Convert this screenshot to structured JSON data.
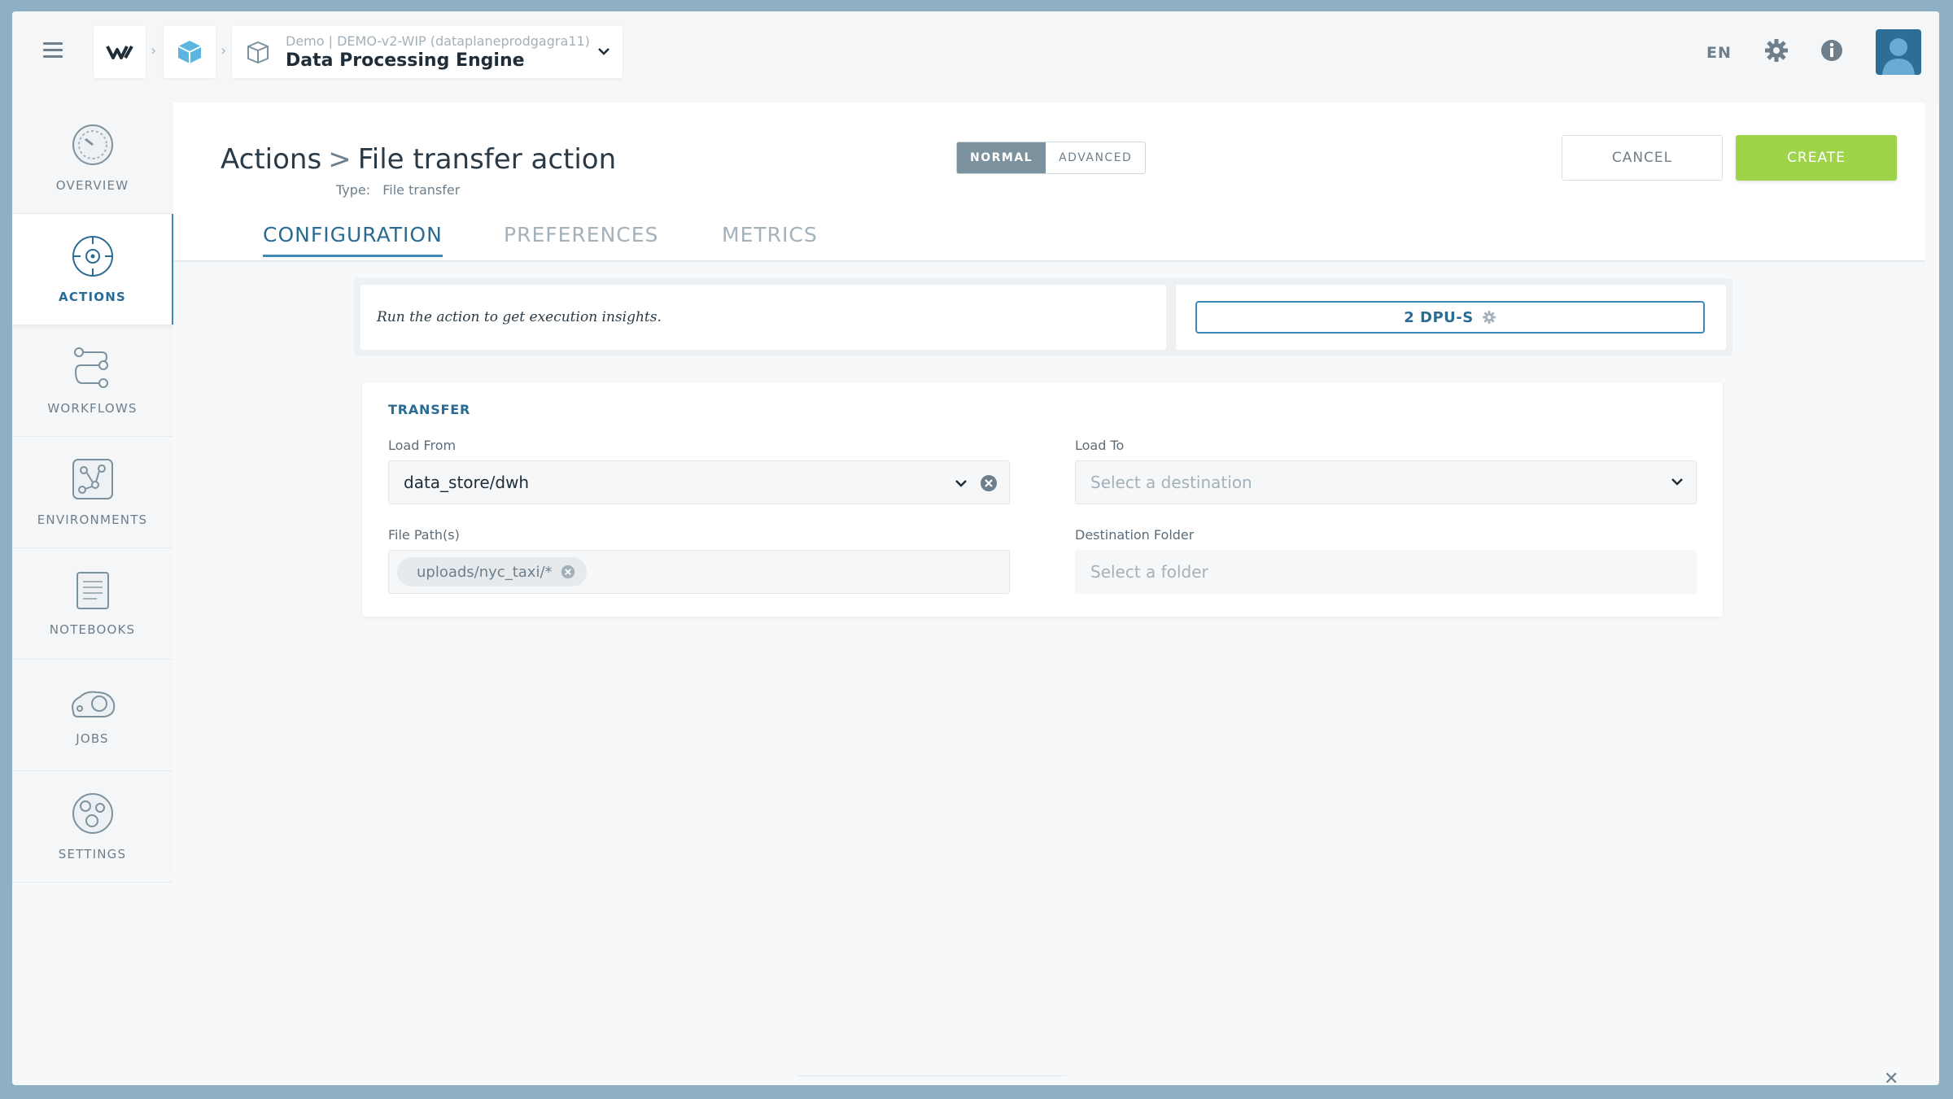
{
  "header": {
    "project_sub": "Demo | DEMO-v2-WIP (dataplaneprodgagra11)",
    "project_name": "Data Processing Engine",
    "lang": "EN"
  },
  "sidebar": {
    "items": [
      {
        "label": "OVERVIEW",
        "icon": "overview-icon"
      },
      {
        "label": "ACTIONS",
        "icon": "actions-icon"
      },
      {
        "label": "WORKFLOWS",
        "icon": "workflows-icon"
      },
      {
        "label": "ENVIRONMENTS",
        "icon": "environments-icon"
      },
      {
        "label": "NOTEBOOKS",
        "icon": "notebooks-icon"
      },
      {
        "label": "JOBS",
        "icon": "jobs-icon"
      },
      {
        "label": "SETTINGS",
        "icon": "settings-icon"
      }
    ],
    "active": "ACTIONS"
  },
  "page": {
    "breadcrumb_root": "Actions",
    "breadcrumb_sep": ">",
    "title": "File transfer action",
    "type_label": "Type:",
    "type_value": "File transfer"
  },
  "mode": {
    "normal": "NORMAL",
    "advanced": "ADVANCED",
    "selected": "NORMAL"
  },
  "buttons": {
    "cancel": "CANCEL",
    "create": "CREATE"
  },
  "tabs": [
    {
      "label": "CONFIGURATION"
    },
    {
      "label": "PREFERENCES"
    },
    {
      "label": "METRICS"
    }
  ],
  "insights": {
    "message": "Run the action to get execution insights.",
    "dpu_label": "2 DPU-S"
  },
  "transfer": {
    "section_title": "TRANSFER",
    "load_from_label": "Load From",
    "load_from_value": "data_store/dwh",
    "load_to_label": "Load To",
    "load_to_placeholder": "Select a destination",
    "file_paths_label": "File Path(s)",
    "file_paths_chip": "uploads/nyc_taxi/*",
    "dest_folder_label": "Destination Folder",
    "dest_folder_placeholder": "Select a folder"
  },
  "colors": {
    "accent": "#3a89b8",
    "create": "#9fd44a",
    "mode_selected": "#7d929f"
  }
}
